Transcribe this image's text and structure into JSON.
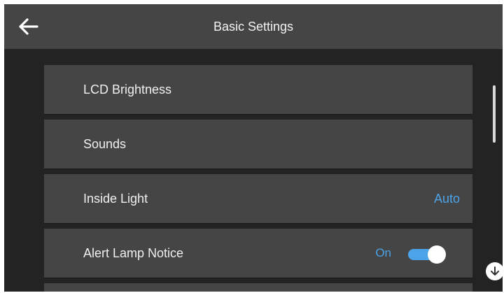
{
  "header": {
    "title": "Basic Settings",
    "back_icon": "arrow-left-icon"
  },
  "settings": [
    {
      "label": "LCD Brightness"
    },
    {
      "label": "Sounds"
    },
    {
      "label": "Inside Light",
      "value": "Auto"
    },
    {
      "label": "Alert Lamp Notice",
      "state": "On",
      "toggle_on": true
    }
  ],
  "scroll": {
    "down_icon": "arrow-down-circle-icon"
  },
  "colors": {
    "background": "#232323",
    "header": "#454545",
    "row": "#454545",
    "accent": "#4ba3e8",
    "text": "#f0f0f0"
  }
}
